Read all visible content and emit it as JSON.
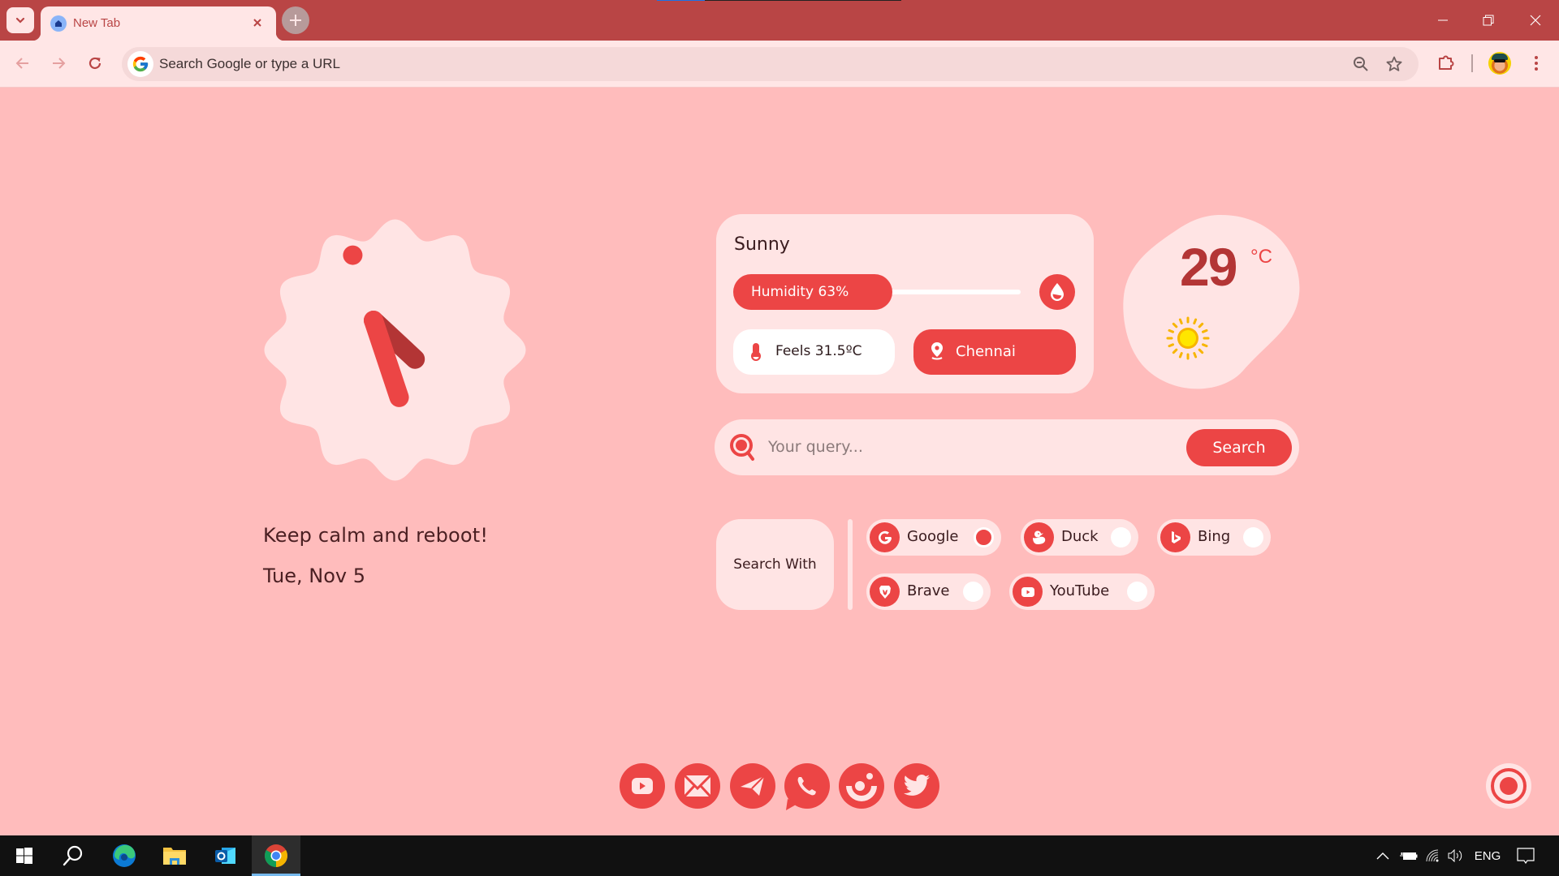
{
  "browser": {
    "tab": {
      "title": "New Tab",
      "favicon": "home-icon"
    },
    "new_tab_label": "+",
    "omnibox": {
      "placeholder": "Search Google or type a URL",
      "value": ""
    },
    "icons": [
      "back-arrow-icon",
      "forward-arrow-icon",
      "reload-icon",
      "zoom-out-icon",
      "bookmark-star-icon",
      "extensions-puzzle-icon",
      "profile-avatar",
      "kebab-menu-icon"
    ],
    "window_controls": [
      "minimize",
      "restore",
      "close"
    ]
  },
  "clock": {
    "hour": 4,
    "minute": 26,
    "second": 56
  },
  "greeting": {
    "quote": "Keep calm and reboot!",
    "date": "Tue, Nov 5"
  },
  "weather": {
    "condition": "Sunny",
    "humidity_label": "Humidity 63%",
    "humidity_percent": 63,
    "feels_like": "Feels 31.5ºC",
    "city": "Chennai",
    "temperature": "29",
    "temperature_unit": "°C",
    "icon": "sun-icon"
  },
  "search": {
    "placeholder": "Your query...",
    "value": "",
    "button_label": "Search"
  },
  "search_with": {
    "label": "Search With",
    "engines": [
      {
        "name": "Google",
        "selected": true
      },
      {
        "name": "Duck",
        "selected": false
      },
      {
        "name": "Bing",
        "selected": false
      },
      {
        "name": "Brave",
        "selected": false
      },
      {
        "name": "YouTube",
        "selected": false
      }
    ]
  },
  "social_links": [
    "youtube",
    "email",
    "telegram",
    "whatsapp",
    "crunchyroll",
    "twitter"
  ],
  "colors": {
    "accent": "#ec4545",
    "accent_dark": "#b33535",
    "page_bg": "#ffbcbc",
    "card_bg": "#ffe4e4",
    "titlebar": "#b94545",
    "text": "#3a1b1e"
  },
  "taskbar": {
    "apps": [
      "start",
      "search",
      "edge",
      "file-explorer",
      "outlook",
      "chrome"
    ],
    "active_app": "chrome",
    "language": "ENG"
  }
}
